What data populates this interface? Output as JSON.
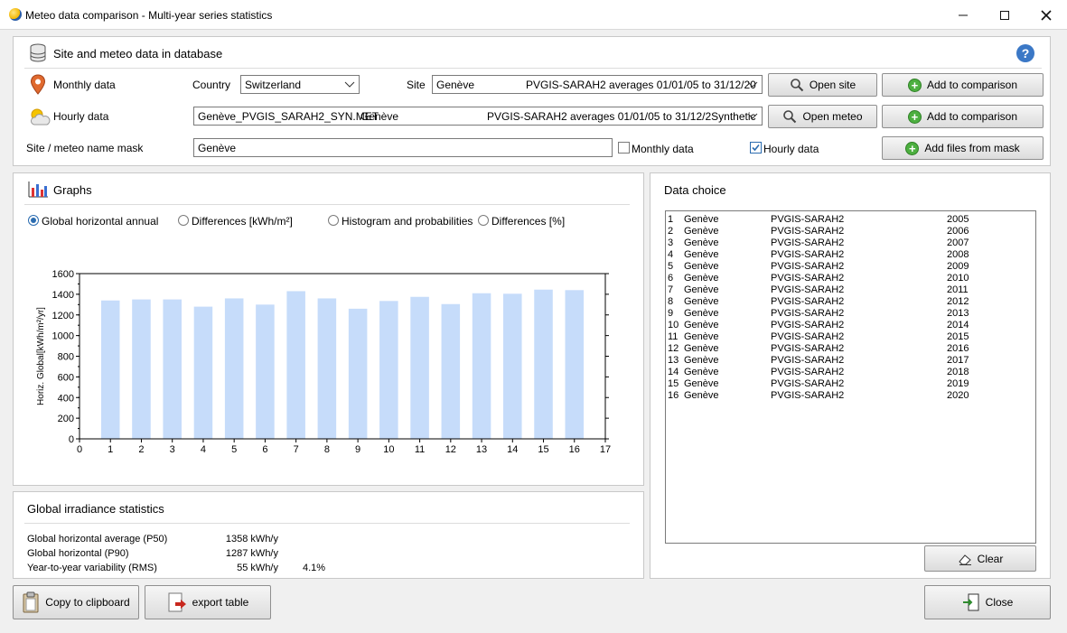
{
  "window": {
    "title": "Meteo data comparison - Multi-year series statistics"
  },
  "database": {
    "title": "Site and meteo data in database",
    "monthly_label": "Monthly data",
    "country_label": "Country",
    "country_value": "Switzerland",
    "site_label": "Site",
    "site_value_name": "Genève",
    "site_value_source": "PVGIS-SARAH2 averages 01/01/05 to 31/12/20",
    "open_site_label": "Open site",
    "add_comparison_label_1": "Add to comparison",
    "hourly_label": "Hourly data",
    "hourly_file": "Genève_PVGIS_SARAH2_SYN.MET",
    "hourly_site": "Genève",
    "hourly_source": "PVGIS-SARAH2 averages 01/01/05 to 31/12/2Synthetic",
    "open_meteo_label": "Open meteo",
    "add_comparison_label_2": "Add to comparison",
    "mask_label": "Site / meteo name mask",
    "mask_value": "Genève",
    "mask_monthly_label": "Monthly data",
    "mask_hourly_label": "Hourly data",
    "add_files_label": "Add files from mask"
  },
  "graphs": {
    "title": "Graphs",
    "options": [
      "Global horizontal annual",
      "Differences [kWh/m²]",
      "Histogram and probabilities",
      "Differences [%]"
    ],
    "selected": 0
  },
  "chart_data": {
    "type": "bar",
    "x": [
      1,
      2,
      3,
      4,
      5,
      6,
      7,
      8,
      9,
      10,
      11,
      12,
      13,
      14,
      15,
      16
    ],
    "values": [
      1340,
      1350,
      1350,
      1280,
      1360,
      1300,
      1430,
      1360,
      1260,
      1335,
      1375,
      1305,
      1410,
      1405,
      1445,
      1440
    ],
    "ylabel": "Horiz. Global[kWh/m²/yr]",
    "xlim": [
      0,
      17
    ],
    "ylim": [
      0,
      1600
    ],
    "yticks": [
      "0",
      "200",
      "400",
      "600",
      "800",
      "1000",
      "1200",
      "1400",
      "1600"
    ],
    "xticks": [
      "0",
      "1",
      "2",
      "3",
      "4",
      "5",
      "6",
      "7",
      "8",
      "9",
      "10",
      "11",
      "12",
      "13",
      "14",
      "15",
      "16",
      "17"
    ],
    "bar_color": "#c6dcfa"
  },
  "stats": {
    "title": "Global irradiance statistics",
    "rows": [
      {
        "label": "Global horizontal average (P50)",
        "value": "1358 kWh/y",
        "extra": ""
      },
      {
        "label": "Global horizontal (P90)",
        "value": "1287 kWh/y",
        "extra": ""
      },
      {
        "label": "Year-to-year variability (RMS)",
        "value": "55 kWh/y",
        "extra": "4.1%"
      }
    ]
  },
  "data_choice": {
    "title": "Data choice",
    "rows": [
      {
        "n": "1",
        "site": "Genève",
        "source": "PVGIS-SARAH2",
        "year": "2005"
      },
      {
        "n": "2",
        "site": "Genève",
        "source": "PVGIS-SARAH2",
        "year": "2006"
      },
      {
        "n": "3",
        "site": "Genève",
        "source": "PVGIS-SARAH2",
        "year": "2007"
      },
      {
        "n": "4",
        "site": "Genève",
        "source": "PVGIS-SARAH2",
        "year": "2008"
      },
      {
        "n": "5",
        "site": "Genève",
        "source": "PVGIS-SARAH2",
        "year": "2009"
      },
      {
        "n": "6",
        "site": "Genève",
        "source": "PVGIS-SARAH2",
        "year": "2010"
      },
      {
        "n": "7",
        "site": "Genève",
        "source": "PVGIS-SARAH2",
        "year": "2011"
      },
      {
        "n": "8",
        "site": "Genève",
        "source": "PVGIS-SARAH2",
        "year": "2012"
      },
      {
        "n": "9",
        "site": "Genève",
        "source": "PVGIS-SARAH2",
        "year": "2013"
      },
      {
        "n": "10",
        "site": "Genève",
        "source": "PVGIS-SARAH2",
        "year": "2014"
      },
      {
        "n": "11",
        "site": "Genève",
        "source": "PVGIS-SARAH2",
        "year": "2015"
      },
      {
        "n": "12",
        "site": "Genève",
        "source": "PVGIS-SARAH2",
        "year": "2016"
      },
      {
        "n": "13",
        "site": "Genève",
        "source": "PVGIS-SARAH2",
        "year": "2017"
      },
      {
        "n": "14",
        "site": "Genève",
        "source": "PVGIS-SARAH2",
        "year": "2018"
      },
      {
        "n": "15",
        "site": "Genève",
        "source": "PVGIS-SARAH2",
        "year": "2019"
      },
      {
        "n": "16",
        "site": "Genève",
        "source": "PVGIS-SARAH2",
        "year": "2020"
      }
    ],
    "clear_label": "Clear"
  },
  "footer": {
    "copy_label": "Copy to clipboard",
    "export_label": "export table",
    "close_label": "Close"
  },
  "colors": {
    "accent": "#2b6cb0",
    "bar": "#c6dcfa",
    "help": "#3b78c6"
  }
}
